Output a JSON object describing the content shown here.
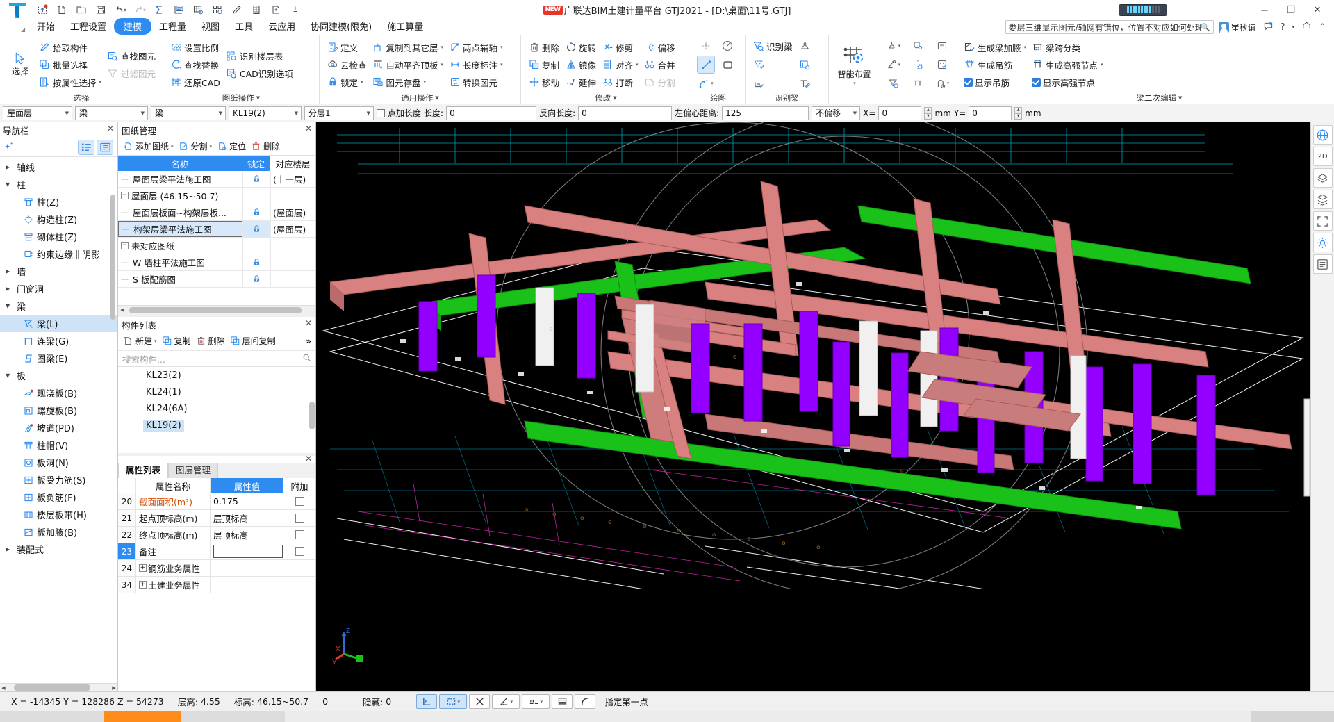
{
  "titlebar": {
    "app_title": "广联达BIM土建计量平台 GTJ2021 - [D:\\桌面\\11号.GTJ]",
    "new_badge": "NEW",
    "quick_access": [
      {
        "name": "upload-icon",
        "glyph": "⬆"
      },
      {
        "name": "new-file-icon",
        "glyph": "🗋"
      },
      {
        "name": "open-folder-icon",
        "glyph": "🗀"
      },
      {
        "name": "save-icon",
        "glyph": "💾"
      },
      {
        "name": "undo-icon",
        "glyph": "↶"
      },
      {
        "name": "redo-icon",
        "glyph": "↷"
      },
      {
        "name": "sum-icon",
        "glyph": "Σ"
      },
      {
        "name": "report-query-icon",
        "glyph": "▤"
      },
      {
        "name": "grid-query-icon",
        "glyph": "▦"
      },
      {
        "name": "struct-query-icon",
        "glyph": "⛶"
      },
      {
        "name": "pen-icon",
        "glyph": "✎"
      },
      {
        "name": "ruler-icon",
        "glyph": "▥"
      },
      {
        "name": "add-page-icon",
        "glyph": "⊞"
      },
      {
        "name": "more-caret-icon",
        "glyph": "▾"
      }
    ],
    "window_buttons": {
      "minimize": "－",
      "maximize": "❐",
      "close": "✕"
    }
  },
  "menubar": {
    "items": [
      {
        "label": "开始",
        "active": false
      },
      {
        "label": "工程设置",
        "active": false
      },
      {
        "label": "建模",
        "active": true
      },
      {
        "label": "工程量",
        "active": false
      },
      {
        "label": "视图",
        "active": false
      },
      {
        "label": "工具",
        "active": false
      },
      {
        "label": "云应用",
        "active": false
      },
      {
        "label": "协同建模(限免)",
        "active": false
      },
      {
        "label": "施工算量",
        "active": false
      }
    ],
    "search_text": "娄层三维显示图元/轴网有错位，位置不对应如何处理？",
    "user_name": "崔秋谊",
    "right_icons": [
      {
        "name": "feedback-icon",
        "glyph": "💬"
      },
      {
        "name": "help-icon",
        "glyph": "?"
      },
      {
        "name": "crown-icon",
        "glyph": "♕"
      },
      {
        "name": "collapse-ribbon-icon",
        "glyph": "⌃"
      }
    ]
  },
  "ribbon": {
    "groups": [
      {
        "title": "选择",
        "big_button": {
          "label": "选择",
          "icon": "cursor-arrow-icon"
        },
        "items": [
          {
            "label": "拾取构件",
            "icon": "pick-element-icon",
            "caret": false,
            "disabled": false
          },
          {
            "label": "批量选择",
            "icon": "batch-select-icon",
            "caret": false,
            "disabled": false
          },
          {
            "label": "按属性选择",
            "icon": "select-by-property-icon",
            "caret": true,
            "disabled": false
          },
          {
            "label": "查找图元",
            "icon": "find-element-icon",
            "caret": false,
            "disabled": false
          },
          {
            "label": "过滤图元",
            "icon": "filter-element-icon",
            "caret": false,
            "disabled": true
          }
        ]
      },
      {
        "title": "图纸操作",
        "title_caret": true,
        "items": [
          {
            "label": "设置比例",
            "icon": "set-scale-icon",
            "caret": false,
            "disabled": false
          },
          {
            "label": "查找替换",
            "icon": "find-replace-icon",
            "caret": false,
            "disabled": false
          },
          {
            "label": "还原CAD",
            "icon": "restore-cad-icon",
            "caret": false,
            "disabled": false
          },
          {
            "label": "识别楼层表",
            "icon": "identify-floor-table-icon",
            "caret": false,
            "disabled": false
          },
          {
            "label": "CAD识别选项",
            "icon": "cad-identify-option-icon",
            "caret": false,
            "disabled": false
          }
        ]
      },
      {
        "title": "通用操作",
        "title_caret": true,
        "items": [
          {
            "label": "定义",
            "icon": "define-icon",
            "caret": false,
            "disabled": false
          },
          {
            "label": "云检查",
            "icon": "cloud-check-icon",
            "caret": false,
            "disabled": false
          },
          {
            "label": "锁定",
            "icon": "lock-icon",
            "caret": true,
            "disabled": false
          },
          {
            "label": "复制到其它层",
            "icon": "copy-to-other-floor-icon",
            "caret": true,
            "disabled": false
          },
          {
            "label": "自动平齐顶板",
            "icon": "auto-align-slab-icon",
            "caret": true,
            "disabled": false
          },
          {
            "label": "图元存盘",
            "icon": "element-save-icon",
            "caret": true,
            "disabled": false
          },
          {
            "label": "两点辅轴",
            "icon": "two-point-axis-icon",
            "caret": true,
            "disabled": false
          },
          {
            "label": "长度标注",
            "icon": "length-dimension-icon",
            "caret": true,
            "disabled": false
          },
          {
            "label": "转换图元",
            "icon": "convert-element-icon",
            "caret": false,
            "disabled": false
          }
        ]
      },
      {
        "title": "修改",
        "title_caret": true,
        "items": [
          {
            "label": "删除",
            "icon": "delete-icon",
            "caret": false,
            "disabled": false
          },
          {
            "label": "复制",
            "icon": "copy-icon",
            "caret": false,
            "disabled": false
          },
          {
            "label": "移动",
            "icon": "move-icon",
            "caret": false,
            "disabled": false
          },
          {
            "label": "旋转",
            "icon": "rotate-icon",
            "caret": false,
            "disabled": false
          },
          {
            "label": "镜像",
            "icon": "mirror-icon",
            "caret": false,
            "disabled": false
          },
          {
            "label": "延伸",
            "icon": "extend-icon",
            "caret": false,
            "disabled": false
          },
          {
            "label": "修剪",
            "icon": "trim-icon",
            "caret": false,
            "disabled": false
          },
          {
            "label": "对齐",
            "icon": "align-icon",
            "caret": true,
            "disabled": false
          },
          {
            "label": "打断",
            "icon": "break-icon",
            "caret": false,
            "disabled": false
          },
          {
            "label": "偏移",
            "icon": "offset-icon",
            "caret": false,
            "disabled": false
          },
          {
            "label": "合并",
            "icon": "merge-icon",
            "caret": false,
            "disabled": false
          },
          {
            "label": "分割",
            "icon": "split-icon",
            "caret": false,
            "disabled": true
          }
        ]
      },
      {
        "title": "绘图",
        "tiles": [
          {
            "name": "point-draw-icon",
            "selected": false
          },
          {
            "name": "arc-center-icon",
            "selected": false
          },
          {
            "name": "line-draw-icon",
            "selected": true
          },
          {
            "name": "rect-draw-icon",
            "selected": false
          },
          {
            "name": "curve-draw-icon",
            "selected": false,
            "caret": true
          }
        ]
      },
      {
        "title": "识别梁",
        "items": [
          {
            "label": "识别梁",
            "icon": "identify-beam-icon",
            "caret": false,
            "disabled": false
          }
        ],
        "tiles": [
          {
            "name": "identify-beam-span-icon"
          },
          {
            "name": "beam-reinforce-icon"
          },
          {
            "name": "check-beam-icon"
          },
          {
            "name": "beam-table-icon"
          },
          {
            "name": "edit-beam-icon"
          }
        ]
      },
      {
        "title": "智能布置",
        "big_button": {
          "label": "智能布置",
          "icon": "smart-layout-icon",
          "caret": true
        }
      },
      {
        "title": "梁二次编辑",
        "title_caret": true,
        "items": [
          {
            "label": "生成梁加腋",
            "icon": "generate-haunch-icon",
            "caret": true,
            "disabled": false
          },
          {
            "label": "生成吊筋",
            "icon": "generate-hanger-icon",
            "caret": false,
            "disabled": false
          },
          {
            "label": "显示吊筋",
            "icon": "show-hanger-checkbox",
            "caret": false,
            "checkbox": true,
            "checked": true
          },
          {
            "label": "梁跨分类",
            "icon": "beam-span-class-icon",
            "caret": false,
            "disabled": false
          },
          {
            "label": "生成高强节点",
            "icon": "generate-strong-node-icon",
            "caret": true,
            "disabled": false
          },
          {
            "label": "显示高强节点",
            "icon": "show-strong-node-checkbox",
            "caret": false,
            "checkbox": true,
            "checked": true
          }
        ],
        "tiles": [
          {
            "name": "apply-beam-icon",
            "caret": true
          },
          {
            "name": "beam-origin-icon"
          },
          {
            "name": "beam-eq-icon"
          },
          {
            "name": "beam-pen-icon",
            "caret": true
          },
          {
            "name": "beam-check-icon"
          },
          {
            "name": "beam-dots-icon"
          },
          {
            "name": "beam-filter-icon"
          },
          {
            "name": "beam-top-icon"
          },
          {
            "name": "beam-arc-icon",
            "caret": true
          }
        ]
      }
    ]
  },
  "optionbar": {
    "floor": "屋面层",
    "category": "梁",
    "subcategory": "梁",
    "component": "KL19(2)",
    "layer": "分层1",
    "point_length_checkbox_label": "点加长度",
    "length_label": "长度:",
    "length_value": "0",
    "reverse_length_label": "反向长度:",
    "reverse_length_value": "0",
    "left_offset_label": "左偏心距离:",
    "left_offset_value": "125",
    "offset_mode": "不偏移",
    "x_label": "X=",
    "x_value": "0",
    "x_unit": "mm",
    "y_label": "Y=",
    "y_value": "0",
    "y_unit": "mm"
  },
  "navpanel": {
    "title": "导航栏",
    "tree": [
      {
        "label": "轴线",
        "level": 0,
        "expanded": false,
        "selected": false,
        "icon": null
      },
      {
        "label": "柱",
        "level": 0,
        "expanded": true,
        "selected": false,
        "icon": null
      },
      {
        "label": "柱(Z)",
        "level": 1,
        "selected": false,
        "icon": "column-icon"
      },
      {
        "label": "构造柱(Z)",
        "level": 1,
        "selected": false,
        "icon": "structural-column-icon"
      },
      {
        "label": "砌体柱(Z)",
        "level": 1,
        "selected": false,
        "icon": "masonry-column-icon"
      },
      {
        "label": "约束边缘非阴影",
        "level": 1,
        "selected": false,
        "icon": "edge-constraint-icon"
      },
      {
        "label": "墙",
        "level": 0,
        "expanded": false,
        "selected": false,
        "icon": null
      },
      {
        "label": "门窗洞",
        "level": 0,
        "expanded": false,
        "selected": false,
        "icon": null
      },
      {
        "label": "梁",
        "level": 0,
        "expanded": true,
        "selected": false,
        "icon": null
      },
      {
        "label": "梁(L)",
        "level": 1,
        "selected": true,
        "icon": "beam-icon"
      },
      {
        "label": "连梁(G)",
        "level": 1,
        "selected": false,
        "icon": "coupling-beam-icon"
      },
      {
        "label": "圈梁(E)",
        "level": 1,
        "selected": false,
        "icon": "ring-beam-icon"
      },
      {
        "label": "板",
        "level": 0,
        "expanded": true,
        "selected": false,
        "icon": null
      },
      {
        "label": "现浇板(B)",
        "level": 1,
        "selected": false,
        "icon": "cast-slab-icon"
      },
      {
        "label": "螺旋板(B)",
        "level": 1,
        "selected": false,
        "icon": "spiral-slab-icon"
      },
      {
        "label": "坡道(PD)",
        "level": 1,
        "selected": false,
        "icon": "ramp-icon"
      },
      {
        "label": "柱帽(V)",
        "level": 1,
        "selected": false,
        "icon": "column-cap-icon"
      },
      {
        "label": "板洞(N)",
        "level": 1,
        "selected": false,
        "icon": "slab-hole-icon"
      },
      {
        "label": "板受力筋(S)",
        "level": 1,
        "selected": false,
        "icon": "slab-main-rebar-icon"
      },
      {
        "label": "板负筋(F)",
        "level": 1,
        "selected": false,
        "icon": "slab-neg-rebar-icon"
      },
      {
        "label": "楼层板带(H)",
        "level": 1,
        "selected": false,
        "icon": "floor-band-icon"
      },
      {
        "label": "板加腋(B)",
        "level": 1,
        "selected": false,
        "icon": "slab-haunch-icon"
      },
      {
        "label": "装配式",
        "level": 0,
        "expanded": false,
        "selected": false,
        "icon": null
      }
    ]
  },
  "drawing_manager": {
    "title": "图纸管理",
    "tools": [
      {
        "label": "添加图纸",
        "icon": "add-drawing-icon",
        "caret": true
      },
      {
        "label": "分割",
        "icon": "split-drawing-icon",
        "caret": true
      },
      {
        "label": "定位",
        "icon": "locate-drawing-icon",
        "caret": false
      },
      {
        "label": "删除",
        "icon": "delete-drawing-icon",
        "caret": false
      }
    ],
    "columns": [
      "名称",
      "锁定",
      "对应楼层"
    ],
    "rows": [
      {
        "name": "屋面层梁平法施工图",
        "type": "leaf",
        "lock": "locked",
        "floor": "(十一层)",
        "selected": false
      },
      {
        "name": "屋面层 (46.15~50.7)",
        "type": "group",
        "lock": "",
        "floor": "",
        "selected": false,
        "expanded": true
      },
      {
        "name": "屋面层板面~构架层板...",
        "type": "leaf",
        "lock": "locked",
        "floor": "(屋面层)",
        "selected": false
      },
      {
        "name": "构架层梁平法施工图",
        "type": "leaf",
        "lock": "locked",
        "floor": "(屋面层)",
        "selected": true
      },
      {
        "name": "未对应图纸",
        "type": "group",
        "lock": "",
        "floor": "",
        "selected": false,
        "expanded": true
      },
      {
        "name": "W 墙柱平法施工图",
        "type": "leaf",
        "lock": "locked",
        "floor": "",
        "selected": false
      },
      {
        "name": "S 板配筋图",
        "type": "leaf",
        "lock": "locked",
        "floor": "",
        "selected": false
      }
    ]
  },
  "component_list": {
    "title": "构件列表",
    "tools": [
      {
        "label": "新建",
        "icon": "new-component-icon",
        "caret": true
      },
      {
        "label": "复制",
        "icon": "copy-component-icon",
        "caret": false
      },
      {
        "label": "删除",
        "icon": "delete-component-icon",
        "caret": false
      },
      {
        "label": "层间复制",
        "icon": "copy-between-floors-icon",
        "caret": false
      },
      {
        "label": "»",
        "icon": "more-tools-icon",
        "caret": false
      }
    ],
    "search_placeholder": "搜索构件...",
    "items": [
      {
        "label": "KL23(2)",
        "selected": false
      },
      {
        "label": "KL24(1)",
        "selected": false
      },
      {
        "label": "KL24(6A)",
        "selected": false
      },
      {
        "label": "KL19(2)",
        "selected": true
      }
    ]
  },
  "property_panel": {
    "tabs": [
      {
        "label": "属性列表",
        "active": true
      },
      {
        "label": "图层管理",
        "active": false
      }
    ],
    "columns": [
      "",
      "属性名称",
      "属性值",
      "附加"
    ],
    "rows": [
      {
        "index": "20",
        "name": "截面面积(m²)",
        "value": "0.175",
        "attach": true,
        "active": false,
        "highlight": true,
        "expander": false
      },
      {
        "index": "21",
        "name": "起点顶标高(m)",
        "value": "层顶标高",
        "attach": true,
        "active": false,
        "highlight": false,
        "expander": false
      },
      {
        "index": "22",
        "name": "终点顶标高(m)",
        "value": "层顶标高",
        "attach": true,
        "active": false,
        "highlight": false,
        "expander": false
      },
      {
        "index": "23",
        "name": "备注",
        "value": "",
        "attach": true,
        "active": true,
        "highlight": false,
        "expander": false,
        "editing": true
      },
      {
        "index": "24",
        "name": "钢筋业务属性",
        "value": "",
        "attach": false,
        "active": false,
        "highlight": false,
        "expander": true
      },
      {
        "index": "34",
        "name": "土建业务属性",
        "value": "",
        "attach": false,
        "active": false,
        "highlight": false,
        "expander": true
      }
    ]
  },
  "viewport_toolbar": [
    {
      "name": "three-d-view-icon",
      "label": ""
    },
    {
      "name": "two-d-view-icon",
      "label": "2D"
    },
    {
      "name": "layer-top-icon",
      "label": ""
    },
    {
      "name": "layer-mid-icon",
      "label": ""
    },
    {
      "name": "fullscreen-icon",
      "label": ""
    },
    {
      "name": "settings-gear-icon",
      "label": ""
    },
    {
      "name": "list-view-icon",
      "label": ""
    }
  ],
  "axis_gizmo": {
    "x": "X",
    "y": "Y",
    "z": "Z"
  },
  "statusbar": {
    "coords": "X = -14345 Y = 128286 Z = 54273",
    "floor_height_label": "层高:",
    "floor_height_value": "4.55",
    "elevation_label": "标高:",
    "elevation_value": "46.15~50.7",
    "zero_value": "0",
    "hidden_label": "隐藏:",
    "hidden_value": "0",
    "tools": [
      {
        "name": "ortho-toggle-icon",
        "selected": true,
        "glyph": "⌐"
      },
      {
        "name": "object-snap-icon",
        "selected": true,
        "glyph": "▭",
        "caret": true
      },
      {
        "name": "no-snap-icon",
        "selected": false,
        "glyph": "✕"
      },
      {
        "name": "angle-snap-icon",
        "selected": false,
        "glyph": "∠",
        "caret": true
      },
      {
        "name": "extension-snap-icon",
        "selected": false,
        "glyph": "⊣",
        "caret": true
      },
      {
        "name": "grid-snap-icon",
        "selected": false,
        "glyph": "▤"
      },
      {
        "name": "arc-snap-icon",
        "selected": false,
        "glyph": "◜"
      }
    ],
    "prompt": "指定第一点"
  }
}
